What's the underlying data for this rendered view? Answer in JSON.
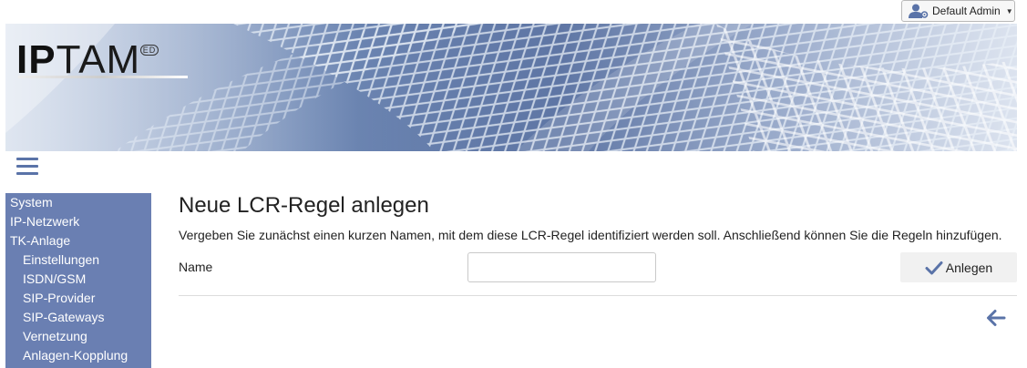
{
  "user_menu": {
    "label": "Default Admin",
    "icon": "user-gear-icon"
  },
  "banner": {
    "logo_main": "IP",
    "logo_rest": "TAM",
    "logo_badge": "ED"
  },
  "nav": {
    "menu_icon": "hamburger-icon",
    "items": [
      {
        "label": "System",
        "level": 0
      },
      {
        "label": "IP-Netzwerk",
        "level": 0
      },
      {
        "label": "TK-Anlage",
        "level": 0
      },
      {
        "label": "Einstellungen",
        "level": 1
      },
      {
        "label": "ISDN/GSM",
        "level": 1
      },
      {
        "label": "SIP-Provider",
        "level": 1
      },
      {
        "label": "SIP-Gateways",
        "level": 1
      },
      {
        "label": "Vernetzung",
        "level": 1
      },
      {
        "label": "Anlagen-Kopplung",
        "level": 1
      }
    ]
  },
  "main": {
    "title": "Neue LCR-Regel anlegen",
    "description": "Vergeben Sie zunächst einen kurzen Namen, mit dem diese LCR-Regel identifiziert werden soll. Anschließend können Sie die Regeln hinzufügen.",
    "name_label": "Name",
    "name_value": "",
    "create_button": "Anlegen",
    "back_icon": "arrow-left-icon"
  },
  "colors": {
    "sidebar_bg": "#6a7fb2",
    "accent": "#5a73a8",
    "button_bg": "#f1f1f1"
  }
}
